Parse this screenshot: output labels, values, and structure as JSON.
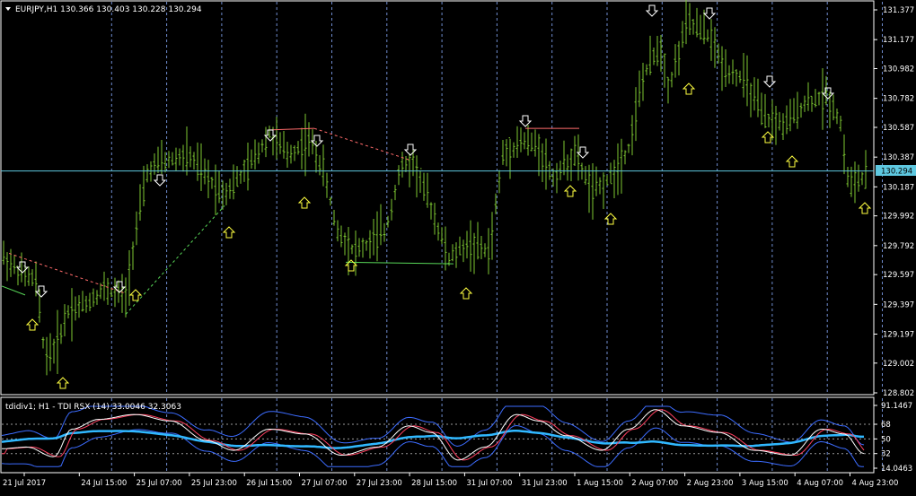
{
  "main_chart": {
    "title": "EURJPY,H1  130.366 130.403 130.228 130.294",
    "current_price": "130.294",
    "price_axis_labels": [
      "131.377",
      "131.177",
      "130.982",
      "130.782",
      "130.587",
      "130.387",
      "130.187",
      "129.992",
      "129.792",
      "129.597",
      "129.397",
      "129.197",
      "129.002",
      "128.802"
    ],
    "price_range": [
      128.802,
      131.377
    ],
    "current_price_value": 130.294
  },
  "indicator_pane": {
    "title": "tdidiv1; H1 - TDI RSX (14) 33.0046 32.3063",
    "axis_labels": [
      "91.1467",
      "68",
      "50",
      "32",
      "14.0463"
    ],
    "range": [
      14.0463,
      91.1467
    ],
    "levels": [
      68,
      50,
      32
    ]
  },
  "time_axis_labels": [
    "21 Jul 2017",
    "24 Jul 15:00",
    "25 Jul 07:00",
    "25 Jul 23:00",
    "26 Jul 15:00",
    "27 Jul 07:00",
    "27 Jul 23:00",
    "28 Jul 15:00",
    "31 Jul 07:00",
    "31 Jul 23:00",
    "1 Aug 15:00",
    "2 Aug 07:00",
    "2 Aug 23:00",
    "3 Aug 15:00",
    "4 Aug 07:00",
    "4 Aug 23:00"
  ],
  "colors": {
    "background": "#000000",
    "bars": "#7ec832",
    "grid_vertical": "#6f8ccf",
    "axis": "#ffffff",
    "price_line": "#5ec8e0",
    "down_arrow": "#ffffff",
    "up_arrow": "#ffff40",
    "divergence_bear": "#ff6b6b",
    "divergence_bull": "#58d858",
    "tdi_upper_band": "#3c6cff",
    "tdi_middle": "#30b8ff",
    "tdi_signal": "#ff4060",
    "tdi_rsi": "#ffffff"
  },
  "icons": {
    "down_arrow": "down-arrow-icon",
    "up_arrow": "up-arrow-icon",
    "dropdown": "dropdown-triangle-icon"
  }
}
